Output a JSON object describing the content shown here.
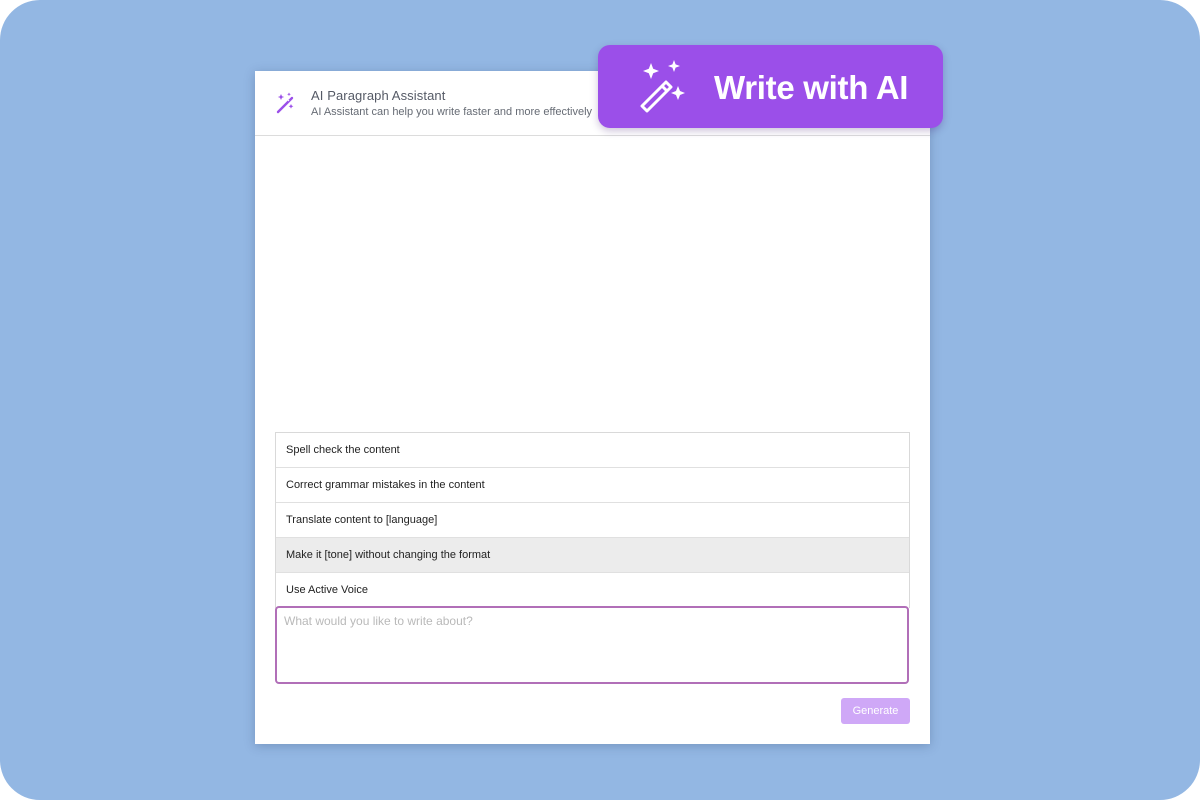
{
  "header": {
    "icon": "magic-wand-icon",
    "title": "AI Paragraph Assistant",
    "subtitle": "AI Assistant can help you write faster and more effectively"
  },
  "badge": {
    "icon": "magic-wand-icon",
    "label": "Write with AI"
  },
  "suggestions": [
    {
      "label": "Spell check the content"
    },
    {
      "label": "Correct grammar mistakes in the content"
    },
    {
      "label": "Translate content to [language]"
    },
    {
      "label": "Make it [tone] without changing the format"
    },
    {
      "label": "Use Active Voice"
    }
  ],
  "prompt": {
    "value": "",
    "placeholder": "What would you like to write about?"
  },
  "generate": {
    "label": "Generate"
  },
  "colors": {
    "background": "#93b7e3",
    "accent": "#9b4fe9",
    "generate_disabled": "#cfa8f7",
    "input_border": "#b16fb8",
    "highlight_row": "#ececec"
  }
}
